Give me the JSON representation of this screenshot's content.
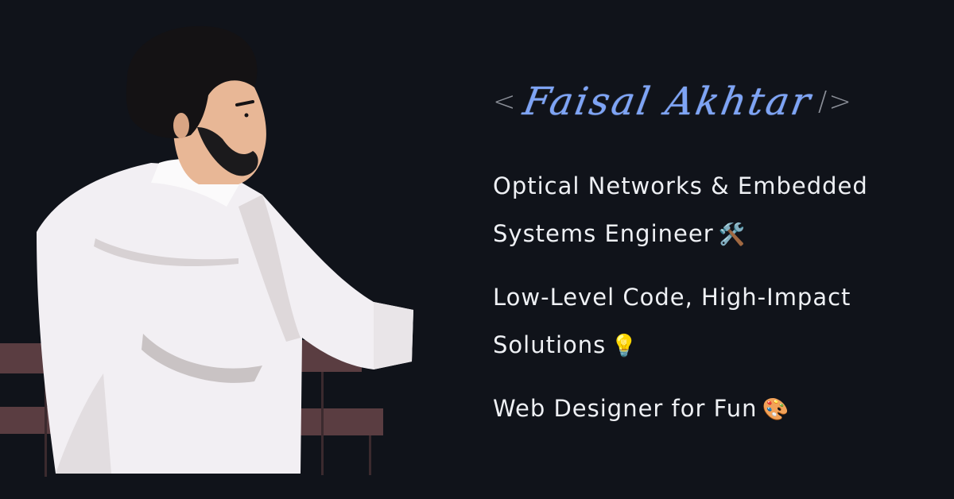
{
  "header": {
    "open_bracket": "<",
    "name": "Faisal Akhtar",
    "close_bracket": "/>"
  },
  "taglines": [
    {
      "line1": "Optical Networks & Embedded",
      "line2": "Systems Engineer",
      "emoji": "🛠️"
    },
    {
      "line1": "Low-Level Code, High-Impact",
      "line2": "Solutions",
      "emoji": "💡"
    },
    {
      "line1": "Web Designer for Fun",
      "line2": "",
      "emoji": "🎨"
    }
  ],
  "illustration": {
    "subject": "man in white shirt leaning on railing",
    "colors": {
      "background": "#10131a",
      "shirt": "#f2eff3",
      "shirt_shadow": "#c9c3c4",
      "rail": "#5a3d41",
      "hair": "#141214",
      "skin": "#e8b796"
    }
  }
}
